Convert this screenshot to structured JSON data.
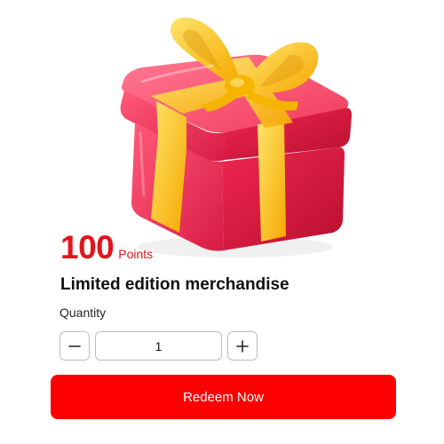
{
  "product": {
    "image_icon": "gift-box-icon",
    "points_value": "100",
    "points_unit": "Points",
    "title": "Limited edition merchandise"
  },
  "quantity": {
    "label": "Quantity",
    "value": "1",
    "decrement_icon": "minus-icon",
    "increment_icon": "plus-icon"
  },
  "actions": {
    "redeem_label": "Redeem Now"
  },
  "colors": {
    "accent": "#e3141c",
    "button": "#fe0000",
    "gift_box": "#f0264f",
    "ribbon": "#fcc31b"
  }
}
